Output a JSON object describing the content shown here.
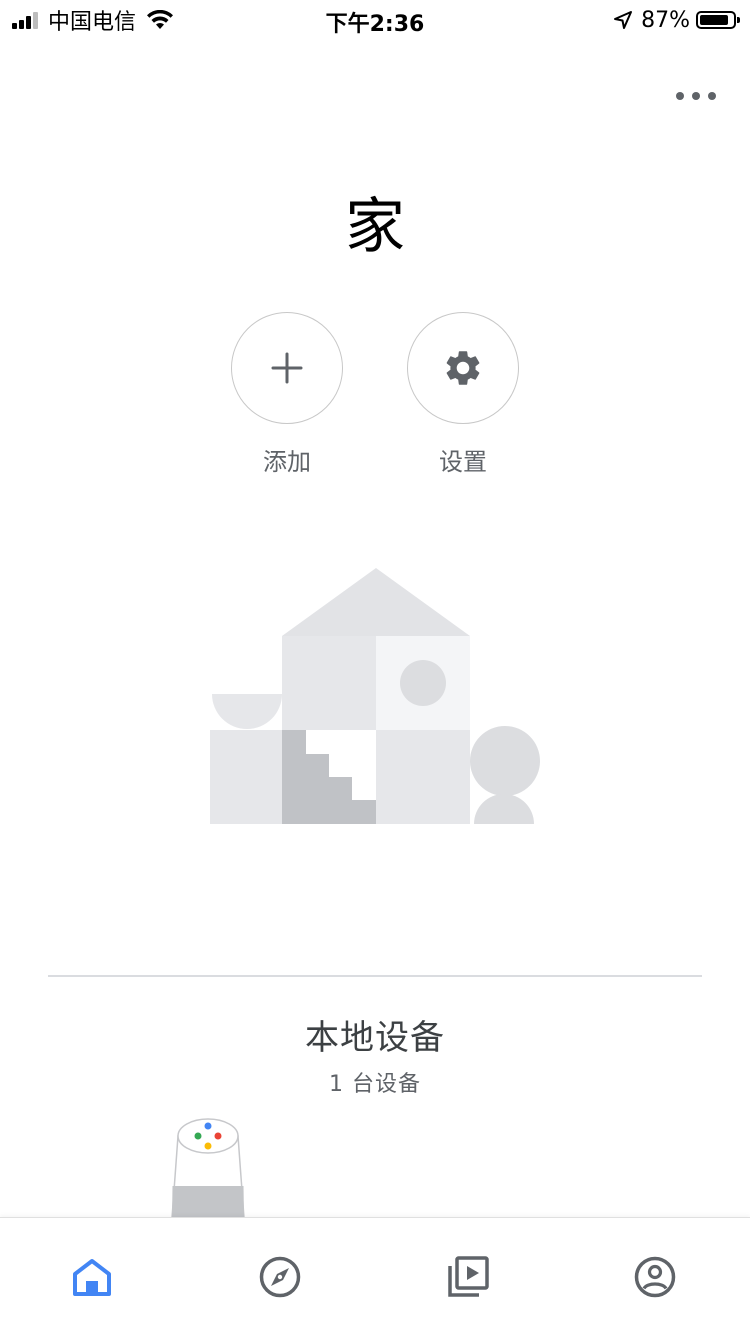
{
  "status_bar": {
    "carrier": "中国电信",
    "time": "下午2:36",
    "battery_percent": "87%",
    "battery_level": 0.87,
    "icons": [
      "signal-icon",
      "wifi-icon",
      "location-arrow-icon",
      "battery-icon"
    ]
  },
  "home": {
    "title": "家",
    "actions": [
      {
        "label": "添加",
        "icon": "plus-icon"
      },
      {
        "label": "设置",
        "icon": "gear-icon"
      }
    ]
  },
  "local_devices": {
    "title": "本地设备",
    "count_text": "1 台设备",
    "device_icon": "google-home-speaker-icon"
  },
  "bottom_nav": {
    "items": [
      {
        "icon": "home-icon",
        "active": true
      },
      {
        "icon": "compass-icon",
        "active": false
      },
      {
        "icon": "media-icon",
        "active": false
      },
      {
        "icon": "account-icon",
        "active": false
      }
    ]
  },
  "colors": {
    "accent": "#4285f4",
    "icon_gray": "#5f6368",
    "google_blue": "#4285f4",
    "google_red": "#ea4335",
    "google_yellow": "#fbbc05",
    "google_green": "#34a853"
  }
}
